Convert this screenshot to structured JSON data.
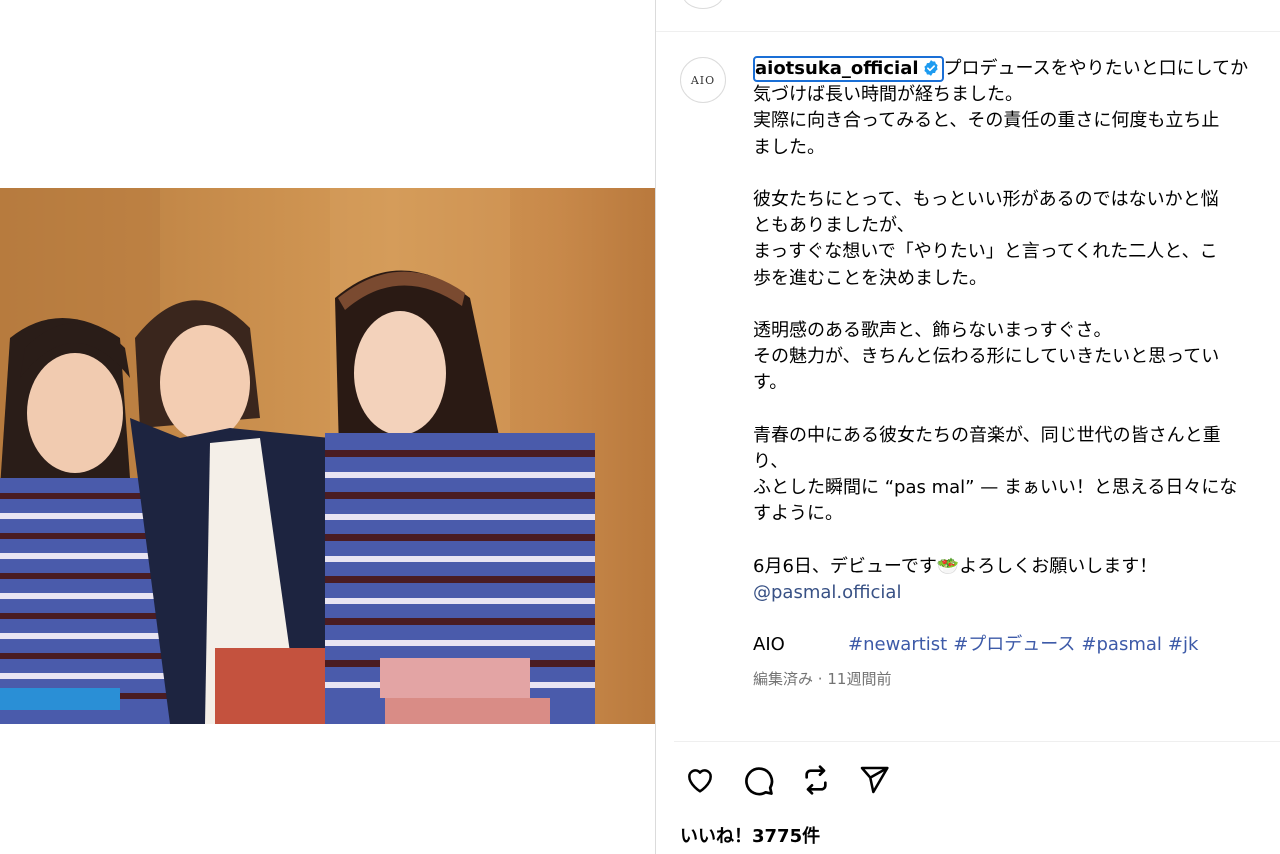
{
  "post": {
    "username": "aiotsuka_official",
    "avatar_text": "AIO",
    "caption_lines": [
      "プロデュースをやりたいと口にしてか",
      "気づけば長い時間が経ちました。",
      "実際に向き合ってみると、その責任の重さに何度も立ち止",
      "ました。",
      "",
      "彼女たちにとって、もっといい形があるのではないかと悩",
      "ともありましたが、",
      "まっすぐな想いで「やりたい」と言ってくれた二人と、こ",
      "歩を進むことを決めました。",
      "",
      "透明感のある歌声と、飾らないまっすぐさ。",
      "その魅力が、きちんと伝わる形にしていきたいと思ってい",
      "す。",
      "",
      "青春の中にある彼女たちの音楽が、同じ世代の皆さんと重",
      "り、",
      "ふとした瞬間に “pas mal” — まぁいい！と思える日々にな",
      "すように。",
      "",
      "6月6日、デビューです🥗よろしくお願いします！"
    ],
    "mention": "@pasmal.official",
    "signature": "AIO",
    "hashtags": [
      "#newartist",
      "#プロデュース",
      "#pasmal",
      "#jk"
    ],
    "edited_label": "編集済み",
    "separator": "·",
    "time_ago": "11週間前",
    "likes": "いいね！3775件"
  },
  "icons": [
    "verified-badge-icon",
    "heart-icon",
    "comment-icon",
    "repost-icon",
    "share-icon"
  ],
  "colors": {
    "verified": "#1d9bf0",
    "focus_ring": "#1a6fd6",
    "hashtag": "#3d5aa8",
    "mention": "#385185"
  }
}
